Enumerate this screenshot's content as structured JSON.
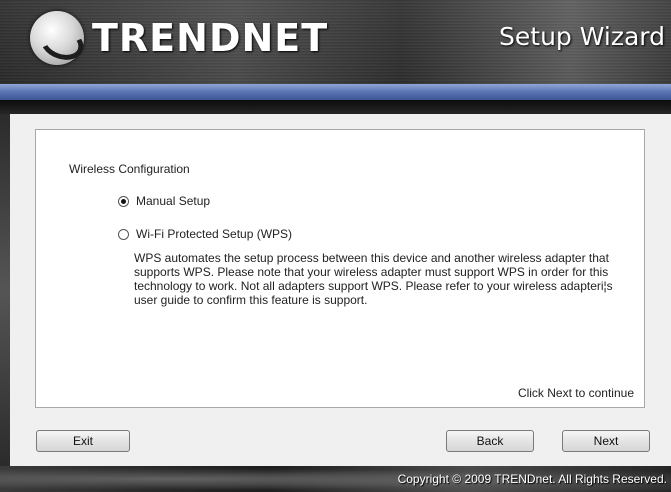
{
  "header": {
    "brand": "TRENDNET",
    "wizard_title": "Setup Wizard"
  },
  "main": {
    "section_label": "Wireless Configuration",
    "options": [
      {
        "label": "Manual Setup",
        "selected": true
      },
      {
        "label": "Wi-Fi Protected Setup (WPS)",
        "selected": false
      }
    ],
    "wps_description": "WPS automates the setup process between this device and another wireless adapter that supports WPS. Please note that your wireless adapter must support WPS in order for this technology to work. Not all adapters support WPS. Please refer to your wireless adapteri¦s user guide to confirm this feature is support.",
    "hint": "Click Next to continue"
  },
  "buttons": {
    "exit": "Exit",
    "back": "Back",
    "next": "Next"
  },
  "footer": {
    "copyright": "Copyright © 2009 TRENDnet. All Rights Reserved."
  },
  "colors": {
    "accent_bar": "#5a74b3",
    "panel_bg": "#f0f0f0"
  },
  "icons": {
    "logo": "trendnet-logo-icon"
  }
}
